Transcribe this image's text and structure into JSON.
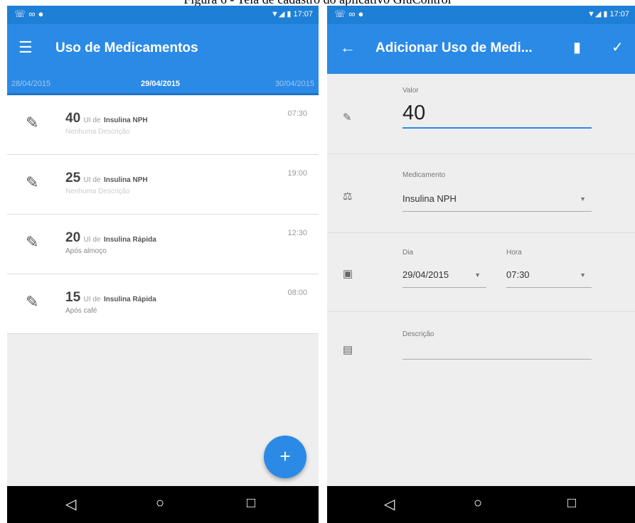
{
  "caption": "Figura 6 - Tela de cadastro do aplicativo GluControl",
  "left_screen": {
    "status_time": "17:07",
    "title": "Uso de Medicamentos",
    "dates": {
      "prev": "28/04/2015",
      "current": "29/04/2015",
      "next": "30/04/2015"
    },
    "entries": [
      {
        "value": "40",
        "unit": "UI de",
        "medication": "Insulina NPH",
        "description": "Nenhuma Descrição",
        "time": "07:30"
      },
      {
        "value": "25",
        "unit": "UI de",
        "medication": "Insulina NPH",
        "description": "Nenhuma Descrição",
        "time": "19:00"
      },
      {
        "value": "20",
        "unit": "UI de",
        "medication": "Insulina Rápida",
        "description": "Após almoço",
        "time": "12:30"
      },
      {
        "value": "15",
        "unit": "UI de",
        "medication": "Insulina Rápida",
        "description": "Após café",
        "time": "08:00"
      }
    ],
    "fab_label": "+"
  },
  "right_screen": {
    "status_time": "17:07",
    "title": "Adicionar Uso de Medi...",
    "form": {
      "value_label": "Valor",
      "value": "40",
      "medication_label": "Medicamento",
      "medication": "Insulina NPH",
      "day_label": "Dia",
      "day": "29/04/2015",
      "hour_label": "Hora",
      "hour": "07:30",
      "description_label": "Descrição",
      "description": ""
    }
  },
  "icons": {
    "menu": "menu-icon",
    "back": "back-arrow-icon",
    "delete": "trash-icon",
    "confirm": "check-icon",
    "entry": "syringe-icon",
    "nav": [
      "back-triangle-icon",
      "home-circle-icon",
      "recents-square-icon"
    ]
  },
  "colors": {
    "primary": "#2b8ae6",
    "status_bar": "#1e7fd6",
    "background": "#eeeeee",
    "nav_bar": "#000000"
  }
}
